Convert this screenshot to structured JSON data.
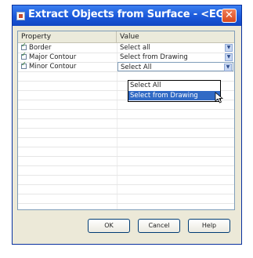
{
  "window": {
    "title": "Extract Objects from Surface - <EG>",
    "close_glyph": "✕"
  },
  "grid": {
    "headers": {
      "property": "Property",
      "value": "Value"
    },
    "rows": [
      {
        "property": "Border",
        "checked": true,
        "value": "Select all"
      },
      {
        "property": "Major Contour",
        "checked": true,
        "value": "Select from Drawing"
      },
      {
        "property": "Minor Contour",
        "checked": true,
        "value": "Select All"
      }
    ],
    "dropdown": {
      "options": [
        "Select All",
        "Select from Drawing"
      ],
      "highlighted_index": 1
    }
  },
  "buttons": {
    "ok": "OK",
    "cancel": "Cancel",
    "help": "Help"
  },
  "colors": {
    "titlebar": "#1b58d9",
    "highlight": "#316ac5",
    "close": "#d8481d"
  },
  "icons": {
    "title": "app-icon",
    "close": "close-icon",
    "dropdown": "chevron-down-icon",
    "cursor": "mouse-pointer-icon"
  }
}
